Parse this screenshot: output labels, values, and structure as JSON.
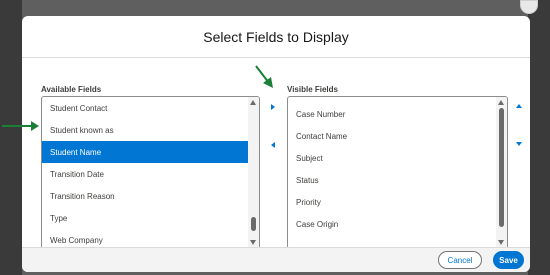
{
  "modal": {
    "title": "Select Fields to Display"
  },
  "available": {
    "label": "Available Fields",
    "items": [
      {
        "label": "Student Contact",
        "selected": false
      },
      {
        "label": "Student known as",
        "selected": false
      },
      {
        "label": "Student Name",
        "selected": true
      },
      {
        "label": "Transition Date",
        "selected": false
      },
      {
        "label": "Transition Reason",
        "selected": false
      },
      {
        "label": "Type",
        "selected": false
      },
      {
        "label": "Web Company",
        "selected": false
      }
    ]
  },
  "visible": {
    "label": "Visible Fields",
    "items": [
      {
        "label": "Case Number"
      },
      {
        "label": "Contact Name"
      },
      {
        "label": "Subject"
      },
      {
        "label": "Status"
      },
      {
        "label": "Priority"
      },
      {
        "label": "Case Origin"
      }
    ]
  },
  "footer": {
    "cancel_label": "Cancel",
    "save_label": "Save"
  },
  "colors": {
    "brand": "#0176d3",
    "annotation": "#1a7f37",
    "overlay": "#5f5f5f"
  },
  "icons": {
    "move_right": "triangle-right-icon",
    "move_left": "triangle-left-icon",
    "move_up": "triangle-up-icon",
    "move_down": "triangle-down-icon",
    "annotation": "green-arrow-icon"
  }
}
